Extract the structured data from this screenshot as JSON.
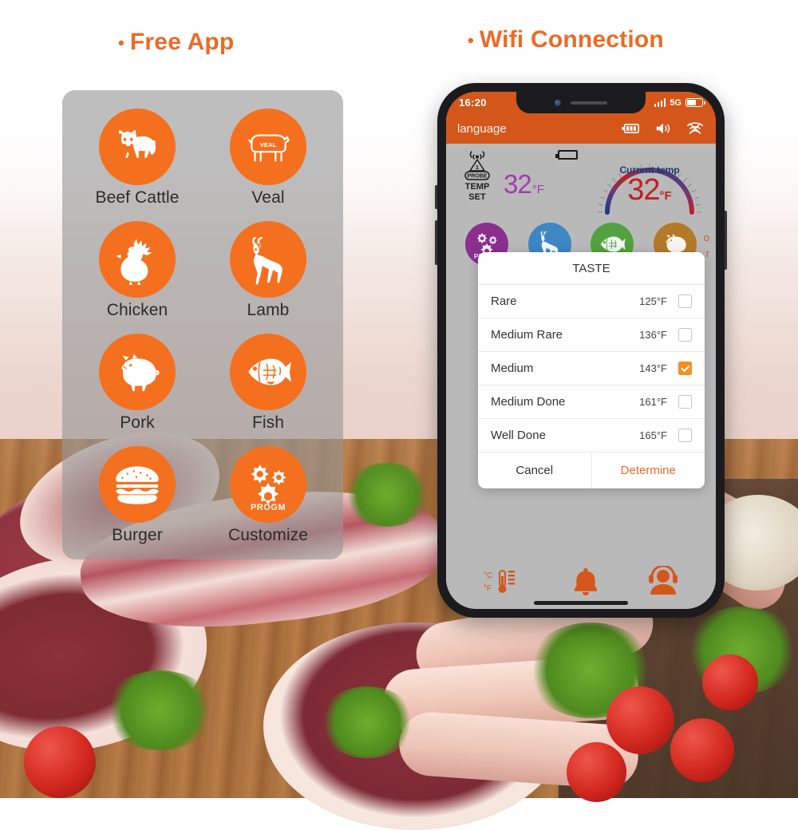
{
  "headlines": {
    "left": "Free App",
    "right": "Wifi Connection",
    "bullet": "•",
    "accent_color": "#EC6A26"
  },
  "icon_panel": {
    "items": [
      {
        "label": "Beef Cattle",
        "icon": "cow-icon"
      },
      {
        "label": "Veal",
        "icon": "veal-cow-outline-icon"
      },
      {
        "label": "Chicken",
        "icon": "chicken-icon"
      },
      {
        "label": "Lamb",
        "icon": "goat-lamb-icon"
      },
      {
        "label": "Pork",
        "icon": "pig-icon"
      },
      {
        "label": "Fish",
        "icon": "fish-icon"
      },
      {
        "label": "Burger",
        "icon": "burger-icon"
      },
      {
        "label": "Customize",
        "icon": "gears-progm-icon"
      }
    ],
    "veal_badge": "VEAL",
    "progm_badge": "PROGM",
    "circle_color": "#F4701F",
    "panel_color": "rgba(150,150,150,0.62)"
  },
  "phone": {
    "status_bar": {
      "time": "16:20",
      "network": "5G",
      "signal_icon": "signal-bars-icon",
      "battery_icon": "battery-icon",
      "background": "#D4561B"
    },
    "app_header": {
      "language_label": "language",
      "icons": [
        "battery-level-icon",
        "speaker-volume-icon",
        "wifi-disconnected-icon"
      ]
    },
    "temp_panel": {
      "probe_label_top": "PROBE",
      "probe_number": "1",
      "probe_caption_line1": "TEMP",
      "probe_caption_line2": "SET",
      "set_temp_value": "32",
      "set_temp_unit": "°F",
      "set_temp_color": "#A23BB0",
      "battery_icon": "device-battery-icon",
      "gauge_title": "Current temp",
      "gauge_value": "32",
      "gauge_unit": "°F",
      "gauge_value_color": "#BF2026"
    },
    "category_circles": [
      {
        "icon": "gears-progm-icon",
        "color": "#8B2F8E",
        "badge": "PROGM"
      },
      {
        "icon": "goat-lamb-icon",
        "color": "#3E86C4",
        "badge": ""
      },
      {
        "icon": "fish-icon",
        "color": "#52A23F",
        "badge": ""
      },
      {
        "icon": "pig-icon",
        "color": "#B5792A",
        "badge": ""
      }
    ],
    "category_circles_row2": [
      {
        "icon": "beef-icon",
        "color": "#4C9A3F",
        "badge": ""
      },
      {
        "icon": "veal-icon",
        "color": "#3E86C4",
        "badge": ""
      }
    ],
    "hidden_text_line1": "o",
    "hidden_text_line2": "r",
    "taste_dialog": {
      "title": "TASTE",
      "rows": [
        {
          "name": "Rare",
          "temp": "125°F",
          "checked": false
        },
        {
          "name": "Medium Rare",
          "temp": "136°F",
          "checked": false
        },
        {
          "name": "Medium",
          "temp": "143°F",
          "checked": true
        },
        {
          "name": "Medium Done",
          "temp": "161°F",
          "checked": false
        },
        {
          "name": "Well Done",
          "temp": "165°F",
          "checked": false
        }
      ],
      "cancel_label": "Cancel",
      "determine_label": "Determine",
      "determine_color": "#EE6A2E",
      "checked_color": "#F4911E"
    },
    "bottom_nav": [
      {
        "icon": "thermometer-unit-toggle-icon",
        "label_top": "°C",
        "label_bottom": "°F"
      },
      {
        "icon": "alarm-bell-icon",
        "label_top": "",
        "label_bottom": ""
      },
      {
        "icon": "support-headset-icon",
        "label_top": "",
        "label_bottom": ""
      }
    ],
    "nav_icon_color": "#D4561B"
  }
}
